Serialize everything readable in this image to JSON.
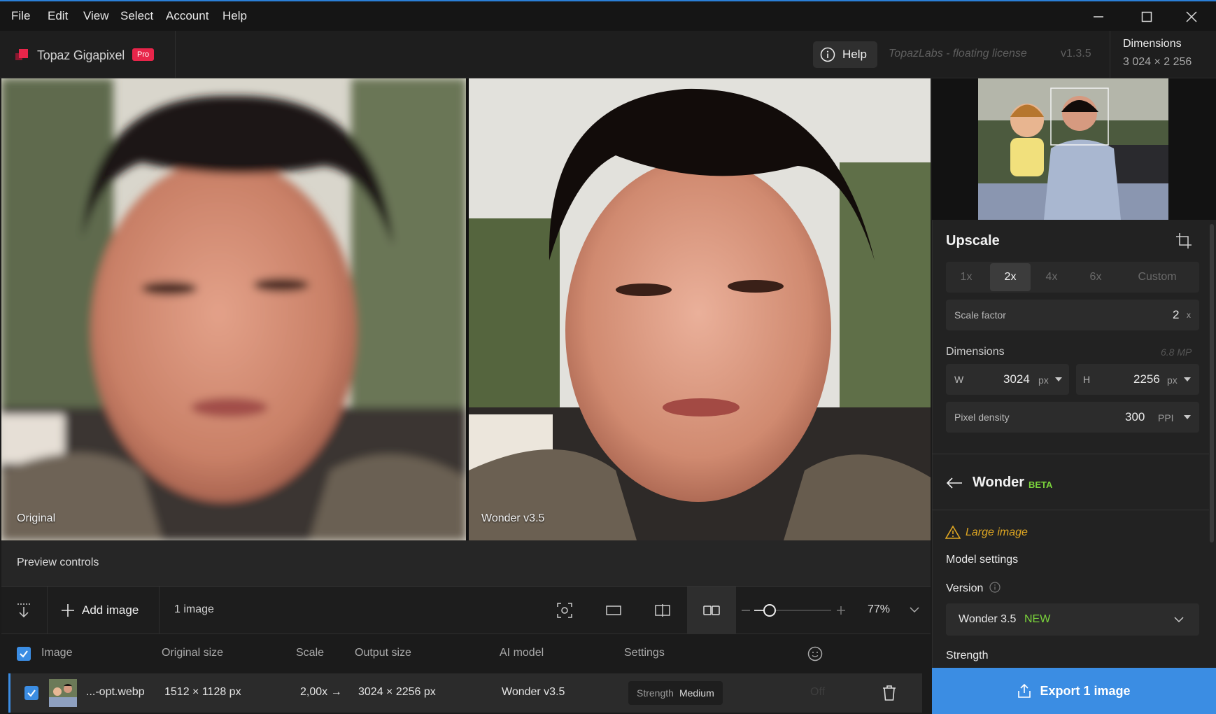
{
  "menu": [
    "File",
    "Edit",
    "View",
    "Select",
    "Account",
    "Help"
  ],
  "header": {
    "app_title": "Topaz Gigapixel",
    "badge": "Pro",
    "help_label": "Help",
    "license": "TopazLabs - floating license",
    "version": "v1.3.5",
    "dimensions_label": "Dimensions",
    "dimensions_value": "3 024 × 2 256"
  },
  "preview": {
    "left_label": "Original",
    "right_label": "Wonder v3.5",
    "controls_label": "Preview controls"
  },
  "toolbar": {
    "add_image": "Add image",
    "image_count": "1 image",
    "zoom": "77%",
    "zoom_level": 0.2
  },
  "table": {
    "headers": [
      "Image",
      "Original size",
      "Scale",
      "Output size",
      "AI model",
      "Settings"
    ],
    "row": {
      "filename": "...-opt.webp",
      "original_size": "1512 × 1128 px",
      "scale": "2,00x →",
      "output_size": "3024 × 2256 px",
      "model": "Wonder v3.5",
      "strength_label": "Strength",
      "strength_value": "Medium",
      "face": "Off"
    }
  },
  "panel": {
    "upscale_title": "Upscale",
    "scale_options": [
      "1x",
      "2x",
      "4x",
      "6x",
      "Custom"
    ],
    "scale_selected": "2x",
    "scale_factor_label": "Scale factor",
    "scale_factor_value": "2",
    "scale_factor_unit": "x",
    "dimensions_label": "Dimensions",
    "megapixels": "6.8 MP",
    "w_label": "W",
    "w_value": "3024",
    "h_label": "H",
    "h_value": "2256",
    "px_unit": "px",
    "pixel_density_label": "Pixel density",
    "pixel_density_value": "300",
    "pixel_density_unit": "PPI",
    "model_title": "Wonder",
    "model_badge": "BETA",
    "warning": "Large image",
    "model_settings": "Model settings",
    "version_label": "Version",
    "version_value": "Wonder 3.5",
    "version_badge": "NEW",
    "strength_label": "Strength",
    "export_label": "Export 1 image"
  },
  "colors": {
    "accent": "#3b8de3",
    "pro_badge": "#e8254a",
    "beta_green": "#7ad33b",
    "warning": "#e0a722"
  }
}
